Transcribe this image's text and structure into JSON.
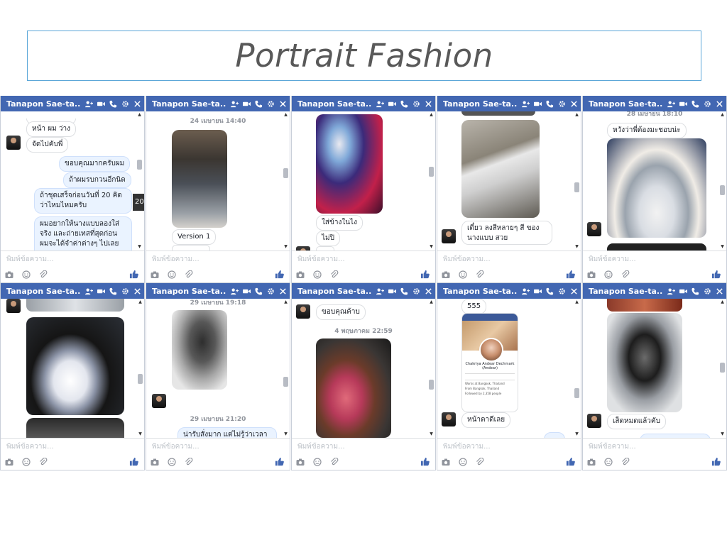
{
  "slide": {
    "title": "Portrait Fashion"
  },
  "windows": [
    {
      "name": "Tanapon Sae-ta...",
      "input_placeholder": "พิมพ์ข้อความ...",
      "messages": [
        "หน้า ผม ว่าง",
        "จัดไปคับพี่",
        "ขอบคุณมากครับผม",
        "ถ้าผมรบกวนอีกนิด",
        "ถ้าชุดเสร็จก่อนวันที่ 20 คิด",
        "ว่าไหมไหมครับ",
        "ผมอยากให้นางแบบลองใส่",
        "จริง และถ่ายเทสที่สุดก่อน",
        "ผมจะได้จำค่าต่างๆ ไปเลย"
      ],
      "tooltip": "20"
    },
    {
      "name": "Tanapon Sae-ta...",
      "input_placeholder": "พิมพ์ข้อความ...",
      "timestamp": "24 เมษายน 14:40",
      "messages": [
        "Version 1"
      ]
    },
    {
      "name": "Tanapon Sae-ta...",
      "input_placeholder": "พิมพ์ข้อความ...",
      "messages": [
        "ใส่ข้างในไง",
        "ไม่ปิ"
      ]
    },
    {
      "name": "Tanapon Sae-ta...",
      "input_placeholder": "พิมพ์ข้อความ...",
      "messages": [
        "เดี๋ยว ลงสีหลายๆ สี ของ",
        "นางแบบ สวย"
      ]
    },
    {
      "name": "Tanapon Sae-ta...",
      "input_placeholder": "พิมพ์ข้อความ...",
      "timestamp": "28 เมษายน 18:10",
      "messages": [
        "หวังว่าพี่ต้องมะชอบน่ะ"
      ]
    },
    {
      "name": "Tanapon Sae-ta...",
      "input_placeholder": "พิมพ์ข้อความ...",
      "messages": []
    },
    {
      "name": "Tanapon Sae-ta...",
      "input_placeholder": "พิมพ์ข้อความ...",
      "timestamp": "29 เมษายน 19:18",
      "timestamp2": "29 เมษายน 21:20",
      "messages": [
        "น่ารับสั่งมาก แต่ไม่รู้ว่าเวลา"
      ]
    },
    {
      "name": "Tanapon Sae-ta...",
      "input_placeholder": "พิมพ์ข้อความ...",
      "timestamp": "4 พฤษภาคม 22:59",
      "messages": [
        "ขอบคุณค้าบ"
      ]
    },
    {
      "name": "Tanapon Sae-ta...",
      "input_placeholder": "พิมพ์ข้อความ...",
      "messages": [
        "555",
        "หน้าตาดีเลย"
      ],
      "profile": {
        "name": "Chakriya Andear Dechmark (Andear)",
        "line1": "Works at Bangkok, Thailand",
        "line2": "From Bangkok, Thailand",
        "line3": "Followed by 2,358 people"
      }
    },
    {
      "name": "Tanapon Sae-ta...",
      "input_placeholder": "พิมพ์ข้อความ...",
      "messages": [
        "เส็ดหมดแล้วคับ"
      ]
    }
  ],
  "colors": {
    "header": "#4267b2",
    "accent": "#5aa6d8",
    "title": "#595959"
  }
}
